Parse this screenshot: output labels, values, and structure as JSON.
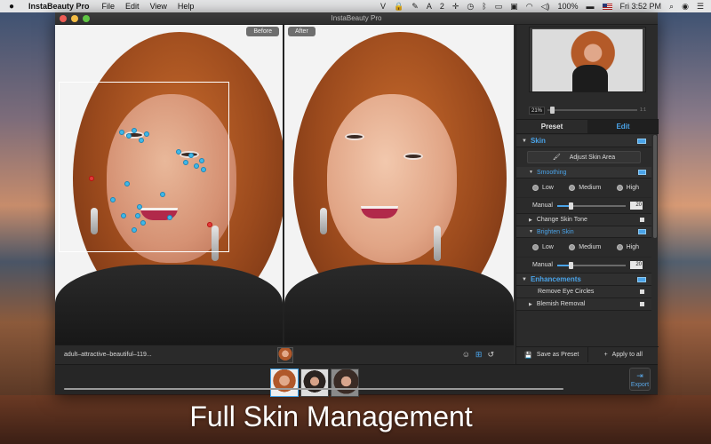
{
  "menubar": {
    "app_name": "InstaBeauty Pro",
    "menus": [
      "File",
      "Edit",
      "View",
      "Help"
    ],
    "badge_count": "2",
    "battery": "100%",
    "clock": "Fri 3:52 PM"
  },
  "window": {
    "title": "InstaBeauty Pro"
  },
  "viewer": {
    "before_label": "Before",
    "after_label": "After",
    "filename": "adult–attractive–beautiful–119..."
  },
  "navigator": {
    "zoom": "21%",
    "zoom_max": "1:1",
    "zoom_fraction": 0.05
  },
  "tabs": [
    {
      "label": "Preset"
    },
    {
      "label": "Edit"
    }
  ],
  "skin": {
    "title": "Skin",
    "adjust_button": "Adjust Skin Area",
    "smoothing": {
      "title": "Smoothing",
      "options": [
        "Low",
        "Medium",
        "High"
      ],
      "manual_label": "Manual",
      "manual_value": "20",
      "fraction": 0.2
    },
    "change_tone": "Change Skin Tone",
    "brighten": {
      "title": "Brighten Skin",
      "options": [
        "Low",
        "Medium",
        "High"
      ],
      "manual_label": "Manual",
      "manual_value": "20",
      "fraction": 0.2
    }
  },
  "enhancements": {
    "title": "Enhancements",
    "items": [
      "Remove Eye Circles",
      "Blemish Removal"
    ]
  },
  "actions": {
    "save_preset": "Save as Preset",
    "apply_all": "Apply to all"
  },
  "bottom": {
    "export_label": "Export",
    "scroll_fraction": 1.0
  },
  "caption": "Full Skin Management"
}
